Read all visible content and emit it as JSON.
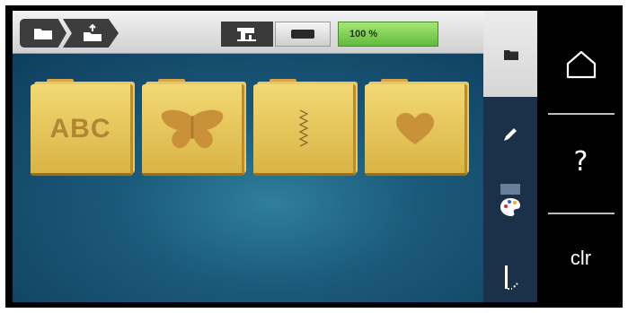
{
  "status": {
    "progress_label": "100 %",
    "progress_fraction": 1.0
  },
  "breadcrumb": [
    {
      "icon": "folder-icon"
    },
    {
      "icon": "folder-import-icon"
    }
  ],
  "toolbar": {
    "machine_icon": "sewing-machine-icon",
    "hoop_icon": "hoop-icon"
  },
  "folders": [
    {
      "name": "alphabets",
      "label": "ABC"
    },
    {
      "name": "animals",
      "icon": "butterfly-icon"
    },
    {
      "name": "stitch-patterns",
      "icon": "zigzag-stitch-icon"
    },
    {
      "name": "hearts",
      "icon": "heart-icon"
    }
  ],
  "side_rail": [
    {
      "name": "folder",
      "icon": "folder-icon"
    },
    {
      "name": "edit",
      "icon": "pencil-icon"
    },
    {
      "name": "color",
      "icon": "color-palette-icon"
    },
    {
      "name": "stitch",
      "icon": "needle-icon"
    }
  ],
  "panel": {
    "home_icon": "home-icon",
    "help_label": "?",
    "clear_label": "clr"
  },
  "colors": {
    "workspace": "#1b5a7a",
    "folder": "#e8c35b",
    "progress": "#7ccf50"
  }
}
